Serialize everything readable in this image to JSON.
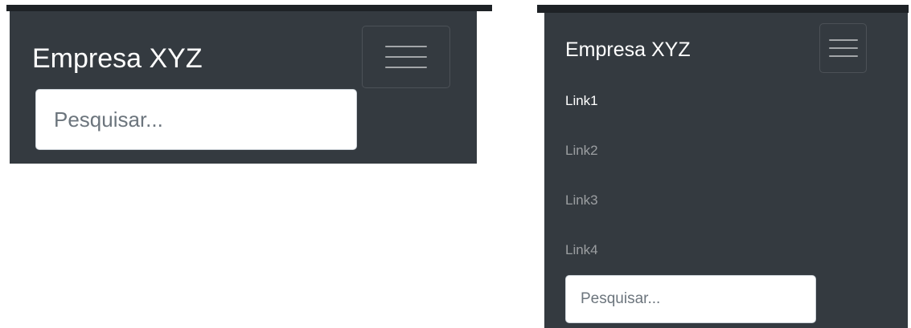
{
  "collapsed": {
    "brand": "Empresa XYZ",
    "search_placeholder": "Pesquisar..."
  },
  "expanded": {
    "brand": "Empresa XYZ",
    "links": [
      {
        "label": "Link1",
        "active": true
      },
      {
        "label": "Link2",
        "active": false
      },
      {
        "label": "Link3",
        "active": false
      },
      {
        "label": "Link4",
        "active": false
      }
    ],
    "search_placeholder": "Pesquisar..."
  },
  "colors": {
    "navbar_bg": "#343a40",
    "link_active": "#ffffff",
    "link_inactive": "rgba(255,255,255,0.5)"
  },
  "icons": {
    "toggler": "hamburger-icon"
  }
}
